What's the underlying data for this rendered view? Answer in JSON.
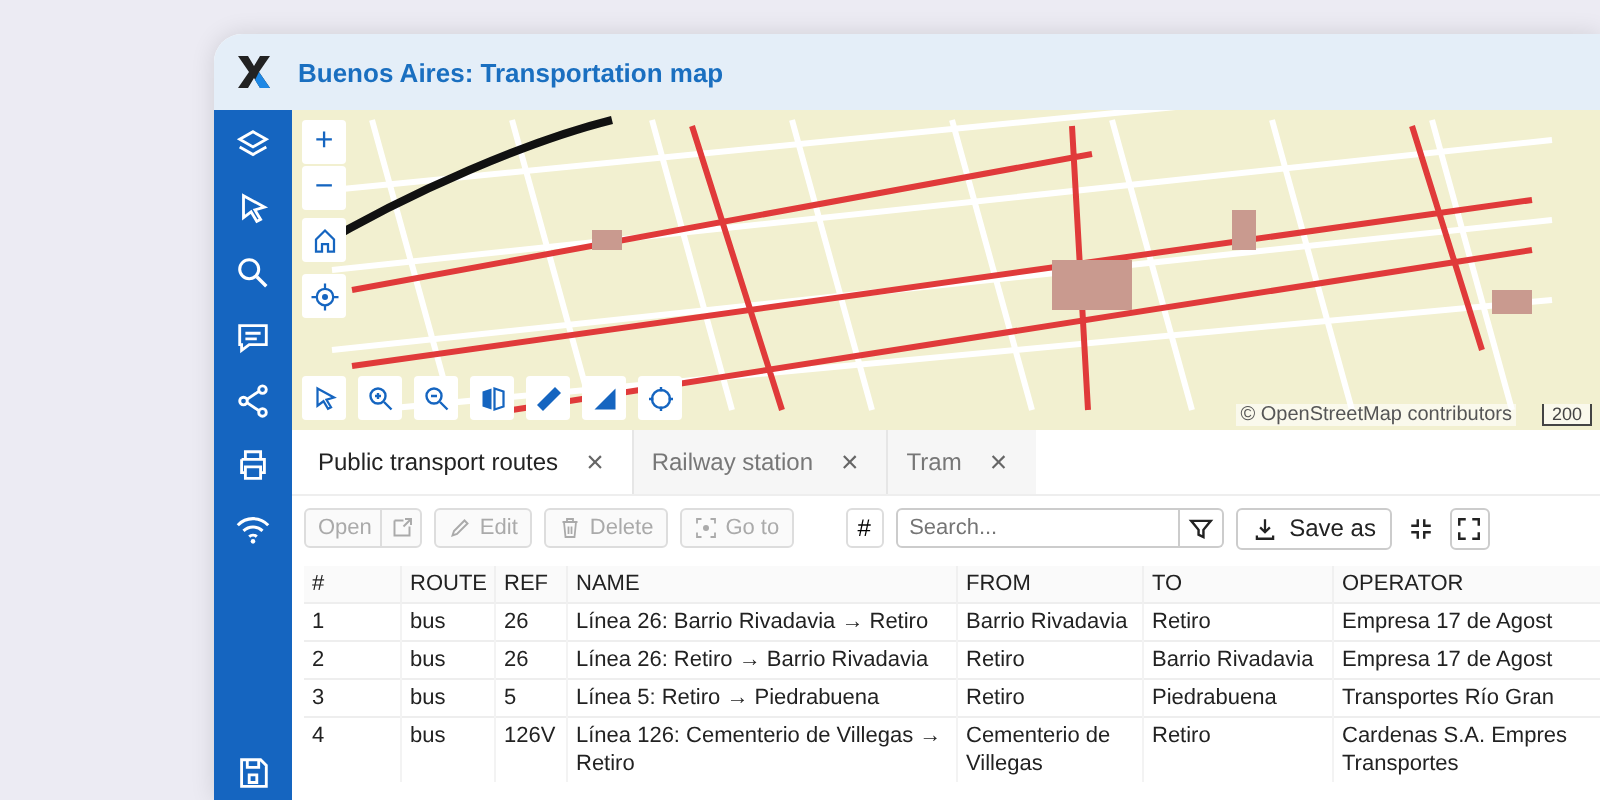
{
  "window": {
    "title": "Buenos Aires: Transportation map"
  },
  "map": {
    "attribution": "© OpenStreetMap contributors",
    "scale": "200",
    "zoom_buttons": [
      {
        "label": "+"
      },
      {
        "label": "−"
      }
    ]
  },
  "tabs": [
    {
      "label": "Public transport routes",
      "close": "×",
      "selected": true
    },
    {
      "label": "Railway station",
      "close": "×",
      "selected": false
    },
    {
      "label": "Tram",
      "close": "×",
      "selected": false
    }
  ],
  "toolbar": {
    "actions": [
      {
        "label": "Open",
        "disabled": true
      },
      {
        "label": "Edit",
        "disabled": true
      },
      {
        "label": "Delete",
        "disabled": true
      },
      {
        "label": "Go to",
        "disabled": true
      }
    ],
    "count_button": "#",
    "search": {
      "placeholder": "Search..."
    },
    "save_button": "Save as"
  },
  "table": {
    "columns": [
      "#",
      "ROUTE",
      "REF",
      "NAME",
      "FROM",
      "TO",
      "OPERATOR"
    ],
    "rows": [
      [
        "1",
        "bus",
        "26",
        "Línea 26: Barrio Rivadavia → Retiro",
        "Barrio Rivadavia",
        "Retiro",
        "Empresa 17 de Agost"
      ],
      [
        "2",
        "bus",
        "26",
        "Línea 26: Retiro → Barrio Rivadavia",
        "Retiro",
        "Barrio Rivadavia",
        "Empresa 17 de Agost"
      ],
      [
        "3",
        "bus",
        "5",
        "Línea 5: Retiro → Piedrabuena",
        "Retiro",
        "Piedrabuena",
        "Transportes Río Gran"
      ],
      [
        "4",
        "bus",
        "126V",
        "Línea 126: Cementerio de Villegas → Retiro",
        "Cementerio de Villegas",
        "Retiro",
        "Cardenas S.A. Empres Transportes"
      ]
    ]
  }
}
